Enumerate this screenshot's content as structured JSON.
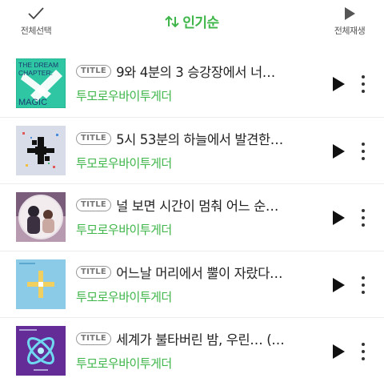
{
  "header": {
    "select_all_label": "전체선택",
    "sort_label": "인기순",
    "play_all_label": "전체재생"
  },
  "badge_label": "TITLE",
  "colors": {
    "accent": "#3fb64a",
    "text": "#222222"
  },
  "songs": [
    {
      "title": "9와 4분의 3 승강장에서 너…",
      "artist": "투모로우바이투게더"
    },
    {
      "title": "5시 53분의 하늘에서 발견한…",
      "artist": "투모로우바이투게더"
    },
    {
      "title": "널 보면 시간이 멈춰 어느 순…",
      "artist": "투모로우바이투게더"
    },
    {
      "title": "어느날 머리에서 뿔이 자랐다…",
      "artist": "투모로우바이투게더"
    },
    {
      "title": "세계가 불타버린 밤, 우린… (…",
      "artist": "투모로우바이투게더"
    }
  ],
  "album_art": [
    {
      "text_line1": "THE DREAM",
      "text_line2": "CHAPTER:",
      "text_line3": "MAGIC"
    }
  ],
  "icons": [
    "check-icon",
    "sort-arrows-icon",
    "play-icon",
    "more-vertical-icon"
  ]
}
